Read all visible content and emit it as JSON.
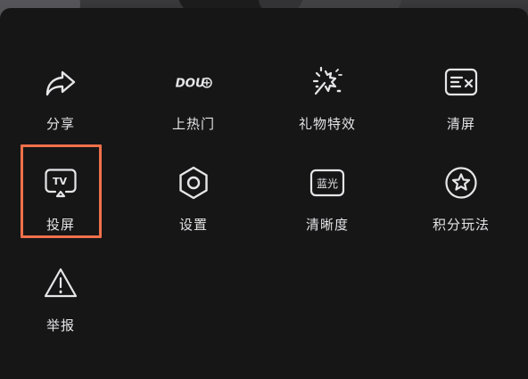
{
  "menu": {
    "items": [
      {
        "id": "share",
        "label": "分享",
        "icon": "share-arrow-icon"
      },
      {
        "id": "dou",
        "label": "上热门",
        "icon": "dou-plus-icon",
        "icon_text": "DOU"
      },
      {
        "id": "gift",
        "label": "礼物特效",
        "icon": "gift-effect-icon"
      },
      {
        "id": "clear",
        "label": "清屏",
        "icon": "clear-screen-icon"
      },
      {
        "id": "cast",
        "label": "投屏",
        "icon": "tv-cast-icon",
        "icon_text": "TV"
      },
      {
        "id": "settings",
        "label": "设置",
        "icon": "settings-hexagon-icon"
      },
      {
        "id": "quality",
        "label": "清晰度",
        "icon": "quality-badge-icon",
        "icon_text": "蓝光"
      },
      {
        "id": "points",
        "label": "积分玩法",
        "icon": "star-circle-icon"
      },
      {
        "id": "report",
        "label": "举报",
        "icon": "warning-triangle-icon"
      }
    ],
    "highlighted": "cast"
  },
  "colors": {
    "panel_bg": "#161617",
    "icon_stroke": "#e6e6e8",
    "label_text": "#e4e4e6",
    "highlight_border": "#f0704a"
  }
}
